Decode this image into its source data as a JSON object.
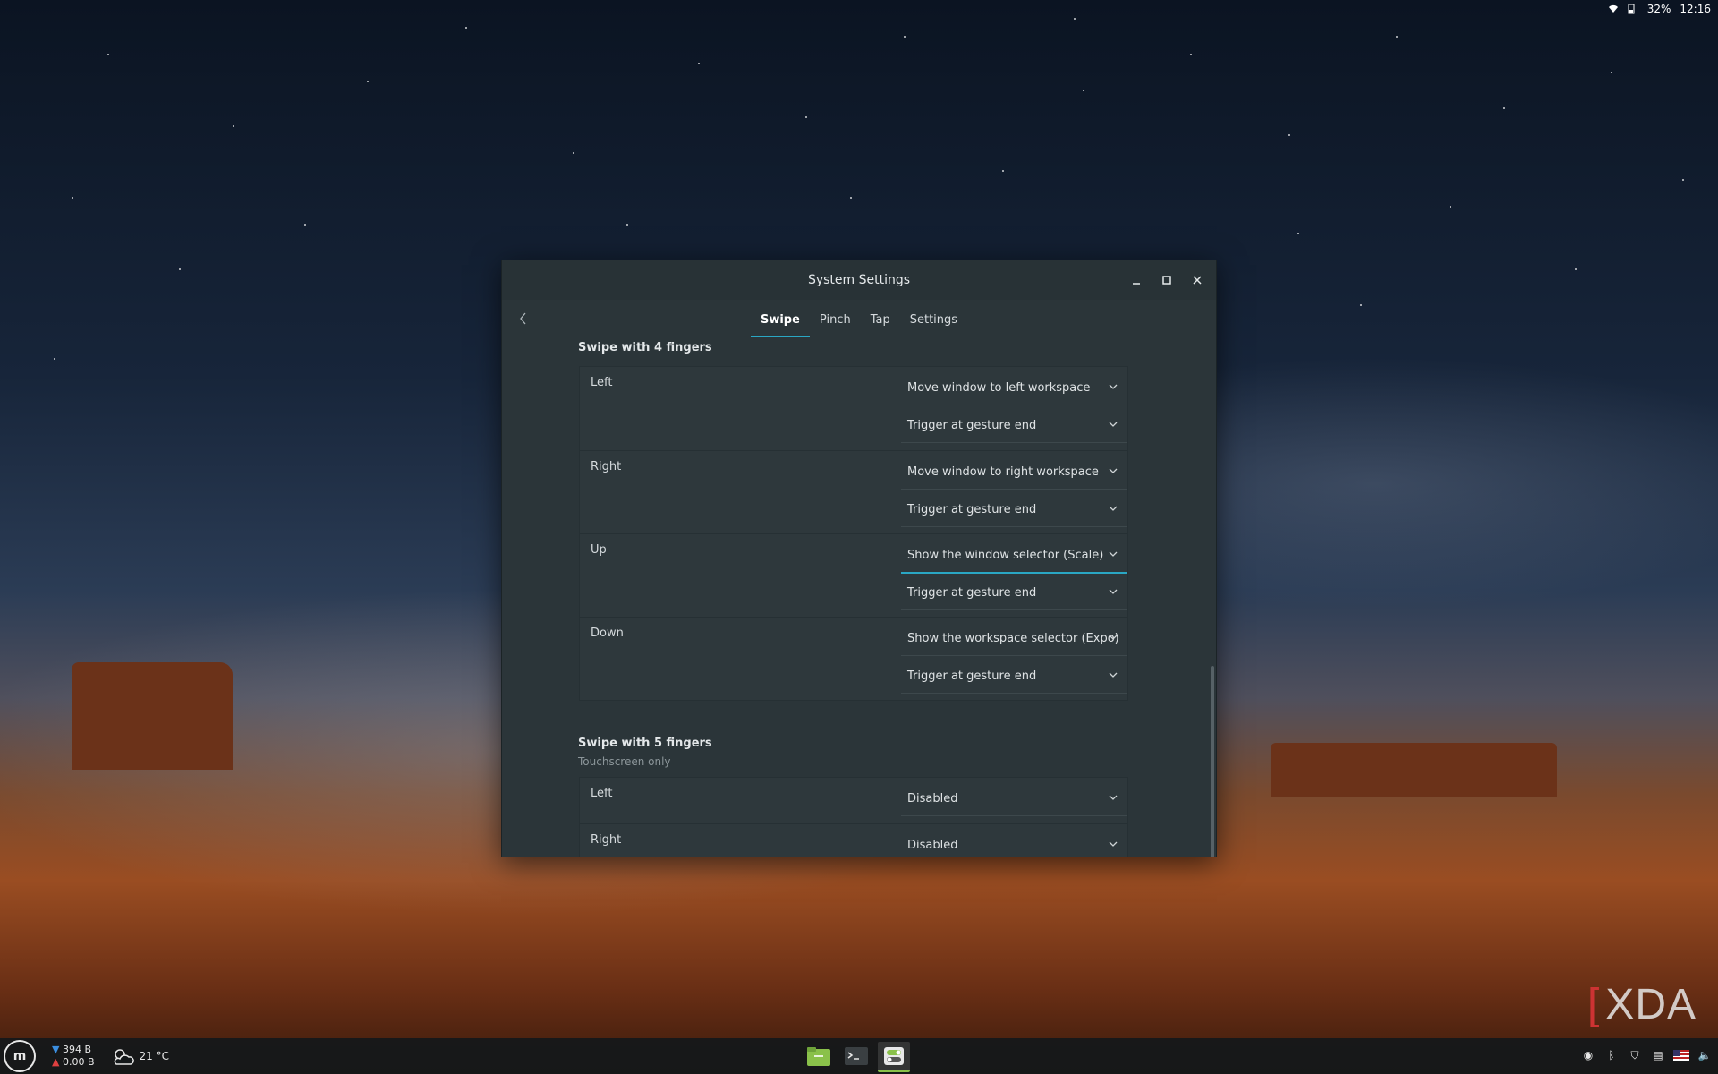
{
  "top_panel": {
    "battery": "32%",
    "time": "12:16"
  },
  "window": {
    "title": "System Settings",
    "tabs": [
      "Swipe",
      "Pinch",
      "Tap",
      "Settings"
    ],
    "active_tab": "Swipe"
  },
  "sections": {
    "four": {
      "title": "Swipe with 4 fingers",
      "rows": [
        {
          "label": "Left",
          "action": "Move window to left workspace",
          "trigger": "Trigger at gesture end"
        },
        {
          "label": "Right",
          "action": "Move window to right workspace",
          "trigger": "Trigger at gesture end"
        },
        {
          "label": "Up",
          "action": "Show the window selector (Scale)",
          "trigger": "Trigger at gesture end"
        },
        {
          "label": "Down",
          "action": "Show the workspace selector (Expo)",
          "trigger": "Trigger at gesture end"
        }
      ]
    },
    "five": {
      "title": "Swipe with 5 fingers",
      "subtitle": "Touchscreen only",
      "rows": [
        {
          "label": "Left",
          "action": "Disabled"
        },
        {
          "label": "Right",
          "action": "Disabled"
        }
      ]
    }
  },
  "taskbar": {
    "net_down": "394 B",
    "net_up": "0.00 B",
    "weather": "21 °C"
  },
  "watermark": "XDA",
  "colors": {
    "accent": "#2aa7c4",
    "window_bg": "#2b3539",
    "mint_active": "#8ac14a"
  }
}
